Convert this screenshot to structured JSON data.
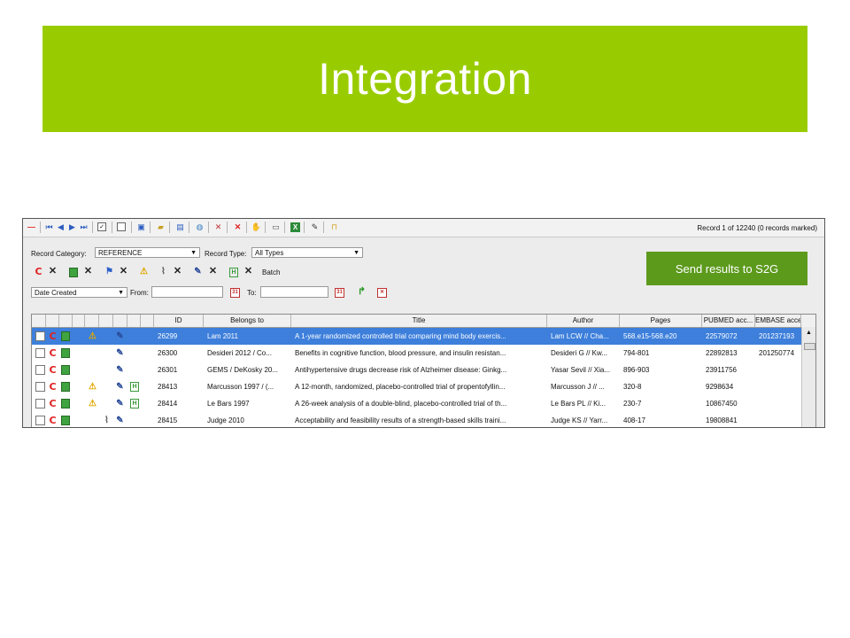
{
  "slide": {
    "title": "Integration"
  },
  "toolbar": {
    "record_count": "Record 1 of 12240 (0 records marked)",
    "icons": [
      "delete-icon",
      "first-icon",
      "prev-icon",
      "next-icon",
      "last-icon",
      "check-icon",
      "uncheck-icon",
      "form-icon",
      "folder-icon",
      "save-icon",
      "globe-icon",
      "tools-icon",
      "cancel-icon",
      "hand-icon",
      "print-icon",
      "excel-icon",
      "edit-icon",
      "lock-icon"
    ]
  },
  "filters": {
    "record_category_label": "Record Category:",
    "record_category_value": "REFERENCE",
    "record_type_label": "Record Type:",
    "record_type_value": "All Types",
    "batch_label": "Batch",
    "date_field_value": "Date Created",
    "from_label": "From:",
    "to_label": "To:",
    "from_value": "",
    "to_value": ""
  },
  "send_button": "Send results to S2G",
  "table": {
    "columns": [
      "ID",
      "Belongs to",
      "Title",
      "Author",
      "Pages",
      "PUBMED acc...",
      "EMBASE acce"
    ],
    "rows": [
      {
        "selected": true,
        "warn": true,
        "clip": false,
        "pen": true,
        "h": false,
        "id": "26299",
        "belongs": "Lam 2011",
        "title": "A 1-year randomized controlled trial comparing mind body exercis...",
        "author": "Lam LCW // Cha...",
        "pages": "568.e15-568.e20",
        "pubmed": "22579072",
        "embase": "201237193"
      },
      {
        "selected": false,
        "warn": false,
        "clip": false,
        "pen": true,
        "h": false,
        "id": "26300",
        "belongs": "Desideri 2012 / Co...",
        "title": "Benefits in cognitive function, blood pressure, and insulin resistan...",
        "author": "Desideri G // Kw...",
        "pages": "794-801",
        "pubmed": "22892813",
        "embase": "201250774"
      },
      {
        "selected": false,
        "warn": false,
        "clip": false,
        "pen": true,
        "h": false,
        "id": "26301",
        "belongs": "GEMS / DeKosky 20...",
        "title": "Antihypertensive drugs decrease risk of Alzheimer disease: Ginkg...",
        "author": "Yasar Sevil // Xia...",
        "pages": "896-903",
        "pubmed": "23911756",
        "embase": ""
      },
      {
        "selected": false,
        "warn": true,
        "clip": false,
        "pen": true,
        "h": true,
        "id": "28413",
        "belongs": "Marcusson 1997 / (...",
        "title": "A 12-month, randomized, placebo-controlled trial of propentofyllin...",
        "author": "Marcusson J // ...",
        "pages": "320-8",
        "pubmed": "9298634",
        "embase": ""
      },
      {
        "selected": false,
        "warn": true,
        "clip": false,
        "pen": true,
        "h": true,
        "id": "28414",
        "belongs": "Le Bars 1997",
        "title": "A 26-week analysis of a double-blind, placebo-controlled trial of th...",
        "author": "Le Bars PL // Ki...",
        "pages": "230-7",
        "pubmed": "10867450",
        "embase": ""
      },
      {
        "selected": false,
        "warn": false,
        "clip": true,
        "pen": true,
        "h": false,
        "id": "28415",
        "belongs": "Judge 2010",
        "title": "Acceptability and feasibility results of a strength-based skills traini...",
        "author": "Judge KS // Yarr...",
        "pages": "408-17",
        "pubmed": "19808841",
        "embase": ""
      }
    ]
  },
  "colors": {
    "banner": "#99cc00",
    "send_button": "#5c9a1c",
    "selection": "#3d7fdb"
  }
}
